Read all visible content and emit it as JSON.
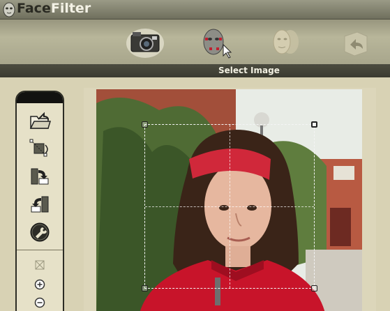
{
  "app": {
    "title_part1": "Face",
    "title_part2": "Filter",
    "logo_icon": "face-mask-icon"
  },
  "steps": [
    {
      "name": "select-image",
      "icon": "camera-icon",
      "active": true
    },
    {
      "name": "mark-face",
      "icon": "face-points-icon",
      "active": false
    },
    {
      "name": "morph",
      "icon": "face-morph-icon",
      "active": false,
      "disabled": true
    },
    {
      "name": "save",
      "icon": "save-arrow-icon",
      "active": false,
      "disabled": true
    }
  ],
  "current_step_label": "Select Image",
  "tools": [
    {
      "name": "open-image",
      "icon": "open-folder-icon"
    },
    {
      "name": "crop-rotate",
      "icon": "crop-rotate-icon"
    },
    {
      "name": "flip-horizontal",
      "icon": "flip-right-icon"
    },
    {
      "name": "flip-back",
      "icon": "flip-left-icon"
    },
    {
      "name": "adjust",
      "icon": "wrench-icon"
    }
  ],
  "zoom_tools": [
    {
      "name": "zoom-fit",
      "icon": "zoom-fit-icon"
    },
    {
      "name": "zoom-in",
      "icon": "zoom-in-icon"
    },
    {
      "name": "zoom-out",
      "icon": "zoom-out-icon"
    }
  ],
  "colors": {
    "titlebar": "#7f7f6b",
    "toolbar": "#b0ae92",
    "band": "#42423a",
    "panel": "#e6e1c8",
    "headband": "#d0283a",
    "shirt": "#c8142a"
  }
}
